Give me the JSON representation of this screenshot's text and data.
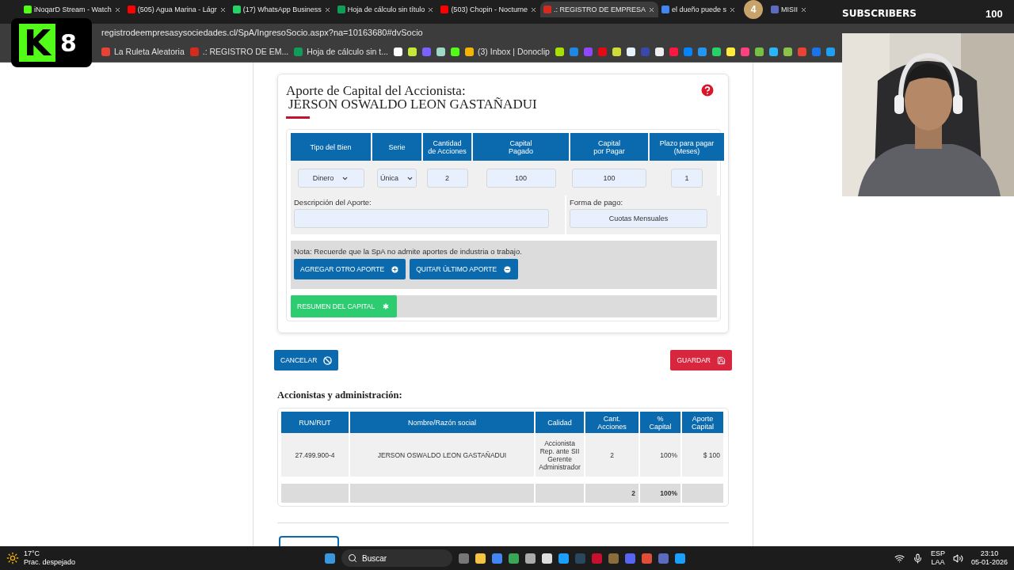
{
  "browser": {
    "tabs": [
      {
        "title": "iNoqarD Stream - Watch",
        "selected": false,
        "color": "#53fc18"
      },
      {
        "title": "(505) Agua Marina - Lágr",
        "selected": false,
        "color": "#ff0000"
      },
      {
        "title": "(17) WhatsApp Business",
        "selected": false,
        "color": "#25d366"
      },
      {
        "title": "Hoja de cálculo sin título",
        "selected": false,
        "color": "#0f9d58"
      },
      {
        "title": "(503) Chopin - Nocturne",
        "selected": false,
        "color": "#ff0000"
      },
      {
        "title": ".: REGISTRO DE EMPRESA",
        "selected": true,
        "color": "#d52b1e"
      },
      {
        "title": "el dueño puede s",
        "selected": false,
        "color": "#4285f4"
      },
      {
        "title": "MISII",
        "selected": false,
        "color": "#5c6bc0"
      }
    ],
    "address": "registrodeempresasysociedades.cl/SpA/IngresoSocio.aspx?na=10163680#dvSocio",
    "bookmarks": [
      {
        "kind": "link",
        "label": "La Ruleta Aleatoria",
        "color": "#e94335"
      },
      {
        "kind": "link",
        "label": ".: REGISTRO DE EM...",
        "color": "#d52b1e"
      },
      {
        "kind": "link",
        "label": "Hoja de cálculo sin t...",
        "color": "#0f9d58"
      },
      {
        "kind": "icon",
        "color": "#ffffff"
      },
      {
        "kind": "icon",
        "color": "#c6e83a"
      },
      {
        "kind": "icon",
        "color": "#7b61ff"
      },
      {
        "kind": "icon",
        "color": "#9fd8c8"
      },
      {
        "kind": "icon",
        "color": "#53fc18"
      },
      {
        "kind": "link",
        "label": "(3) Inbox | Donoclip",
        "color": "#f4b400"
      },
      {
        "kind": "icon",
        "color": "#a8e000"
      },
      {
        "kind": "icon",
        "color": "#1e88e5"
      },
      {
        "kind": "icon",
        "color": "#9146ff"
      },
      {
        "kind": "icon",
        "color": "#e50914"
      },
      {
        "kind": "icon",
        "color": "#cddc39"
      },
      {
        "kind": "icon",
        "color": "#e3f2fd"
      },
      {
        "kind": "icon",
        "color": "#3949ab"
      },
      {
        "kind": "icon",
        "color": "#eeeeee"
      },
      {
        "kind": "icon",
        "color": "#ff1744"
      },
      {
        "kind": "icon",
        "color": "#0084ff"
      },
      {
        "kind": "icon",
        "color": "#2196f3"
      },
      {
        "kind": "icon",
        "color": "#25d366"
      },
      {
        "kind": "icon",
        "color": "#ffeb3b"
      },
      {
        "kind": "icon",
        "color": "#ff4081"
      },
      {
        "kind": "icon",
        "color": "#76c043"
      },
      {
        "kind": "icon",
        "color": "#29b6f6"
      },
      {
        "kind": "icon",
        "color": "#8bc34a"
      },
      {
        "kind": "icon",
        "color": "#ea4335"
      },
      {
        "kind": "icon",
        "color": "#1a73e8"
      },
      {
        "kind": "icon",
        "color": "#1da1f2"
      }
    ]
  },
  "overlay": {
    "logo_letter": "K",
    "logo_number": "8",
    "badge_count": "4",
    "badge_label": "SUBSCRIBERS",
    "badge_goal": "100"
  },
  "contribution": {
    "title": "Aporte de Capital del Accionista:",
    "shareholder": "JERSON OSWALDO LEON GASTAÑADUI",
    "columns": [
      "Tipo del Bien",
      "Serie",
      "Cantidad\nde Acciones",
      "Capital\nPagado",
      "Capital\npor Pagar",
      "Plazo para pagar\n(Meses)"
    ],
    "fields": [
      {
        "kind": "select",
        "value": "Dinero"
      },
      {
        "kind": "select",
        "value": "Única"
      },
      {
        "kind": "input",
        "value": "2"
      },
      {
        "kind": "input",
        "value": "100"
      },
      {
        "kind": "input",
        "value": "100"
      },
      {
        "kind": "input",
        "value": "1"
      }
    ],
    "description_label": "Descripción del Aporte:",
    "payment_label": "Forma de pago:",
    "payment_value": "Cuotas Mensuales",
    "note": "Nota: Recuerde que la SpA no admite aportes de industria o trabajo.",
    "add_button": "AGREGAR OTRO APORTE",
    "remove_button": "QUITAR ÚLTIMO APORTE",
    "summary_button": "RESUMEN DEL CAPITAL"
  },
  "actions": {
    "cancel": "CANCELAR",
    "save": "GUARDAR"
  },
  "shareholders": {
    "title": "Accionistas y administración:",
    "columns": [
      "RUN/RUT",
      "Nombre/Razón social",
      "Calidad",
      "Cant.\nAcciones",
      "%\nCapital",
      "Aporte\nCapital"
    ],
    "rows": [
      [
        "27.499.900-4",
        "JERSON OSWALDO LEON GASTAÑADUI",
        "Accionista\nRep. ante SII\nGerente\nAdministrador",
        "2",
        "100%",
        "$ 100"
      ]
    ],
    "totals": {
      "shares": "2",
      "percent": "100%"
    }
  },
  "taskbar": {
    "temperature": "17°C",
    "weather": "Prac. despejado",
    "search": "Buscar",
    "language": "ESP",
    "layout": "LAA",
    "time": "23:10",
    "date": "05-01-2026"
  }
}
